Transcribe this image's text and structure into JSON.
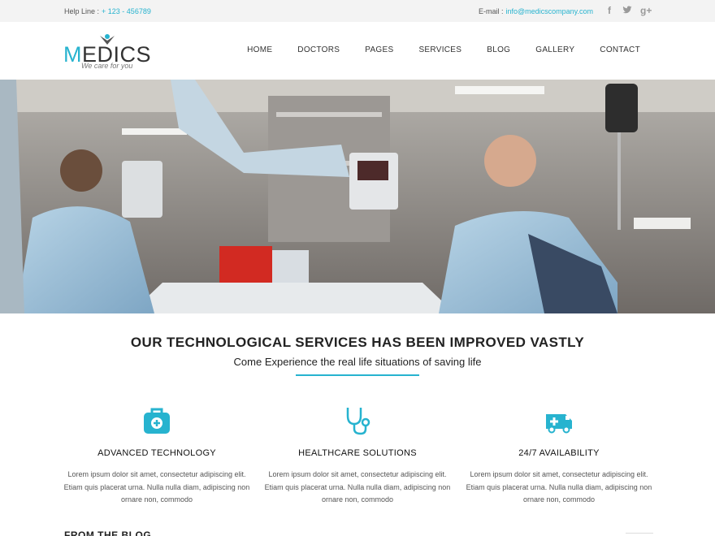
{
  "topbar": {
    "help_label": "Help Line :",
    "help_value": "+ 123 - 456789",
    "email_label": "E-mail :",
    "email_value": "info@medicscompany.com",
    "social": [
      "facebook-icon",
      "twitter-icon",
      "google-plus-icon"
    ]
  },
  "brand": {
    "name_first": "M",
    "name_rest": "EDICS",
    "tagline": "We care for you",
    "accent_color": "#27b3cf"
  },
  "nav": {
    "items": [
      "HOME",
      "DOCTORS",
      "PAGES",
      "SERVICES",
      "BLOG",
      "GALLERY",
      "CONTACT"
    ]
  },
  "intro": {
    "title": "OUR TECHNOLOGICAL SERVICES HAS BEEN IMPROVED VASTLY",
    "subtitle": "Come Experience the real life situations of saving life"
  },
  "features": [
    {
      "icon": "medical-kit-icon",
      "title": "ADVANCED TECHNOLOGY",
      "text": "Lorem ipsum dolor sit amet, consectetur adipiscing elit. Etiam quis placerat urna. Nulla nulla diam, adipiscing non ornare non, commodo"
    },
    {
      "icon": "stethoscope-icon",
      "title": "HEALTHCARE SOLUTIONS",
      "text": "Lorem ipsum dolor sit amet, consectetur adipiscing elit. Etiam quis placerat urna. Nulla nulla diam, adipiscing non ornare non, commodo"
    },
    {
      "icon": "ambulance-icon",
      "title": "24/7 AVAILABILITY",
      "text": "Lorem ipsum dolor sit amet, consectetur adipiscing elit. Etiam quis placerat urna. Nulla nulla diam, adipiscing non ornare non, commodo"
    }
  ],
  "blog": {
    "heading_partial": "FROM THE BLOG"
  }
}
